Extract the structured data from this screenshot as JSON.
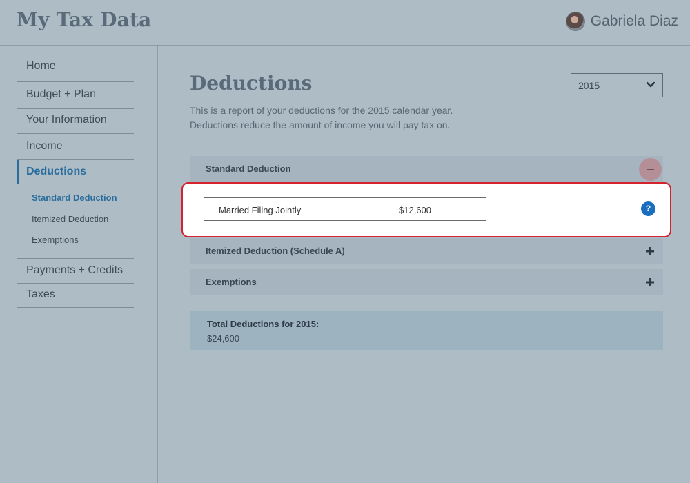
{
  "header": {
    "app_title": "My Tax Data",
    "user_name": "Gabriela Diaz"
  },
  "sidebar": {
    "items": [
      {
        "label": "Home"
      },
      {
        "label": "Budget + Plan"
      },
      {
        "label": "Your Information"
      },
      {
        "label": "Income"
      },
      {
        "label": "Deductions",
        "active": true
      },
      {
        "label": "Payments + Credits"
      },
      {
        "label": "Taxes"
      }
    ],
    "sub_items": [
      {
        "label": "Standard Deduction",
        "active": true
      },
      {
        "label": "Itemized Deduction"
      },
      {
        "label": "Exemptions"
      }
    ]
  },
  "main": {
    "title": "Deductions",
    "year_select": {
      "selected": "2015"
    },
    "description_line1": "This is a report of your deductions for the 2015 calendar year.",
    "description_line2": "Deductions reduce the amount of income you will pay tax on.",
    "sections": [
      {
        "label": "Standard Deduction",
        "expanded": true
      },
      {
        "label": "Itemized Deduction (Schedule A)",
        "expanded": false
      },
      {
        "label": "Exemptions",
        "expanded": false
      }
    ],
    "standard_deduction": {
      "label": "Married Filing Jointly",
      "value": "$12,600",
      "help_glyph": "?"
    },
    "total": {
      "label": "Total Deductions for 2015:",
      "value": "$24,600"
    }
  },
  "colors": {
    "accent": "#2a6d9c",
    "highlight_border": "#d4222f",
    "help_icon": "#1a6ec0"
  }
}
